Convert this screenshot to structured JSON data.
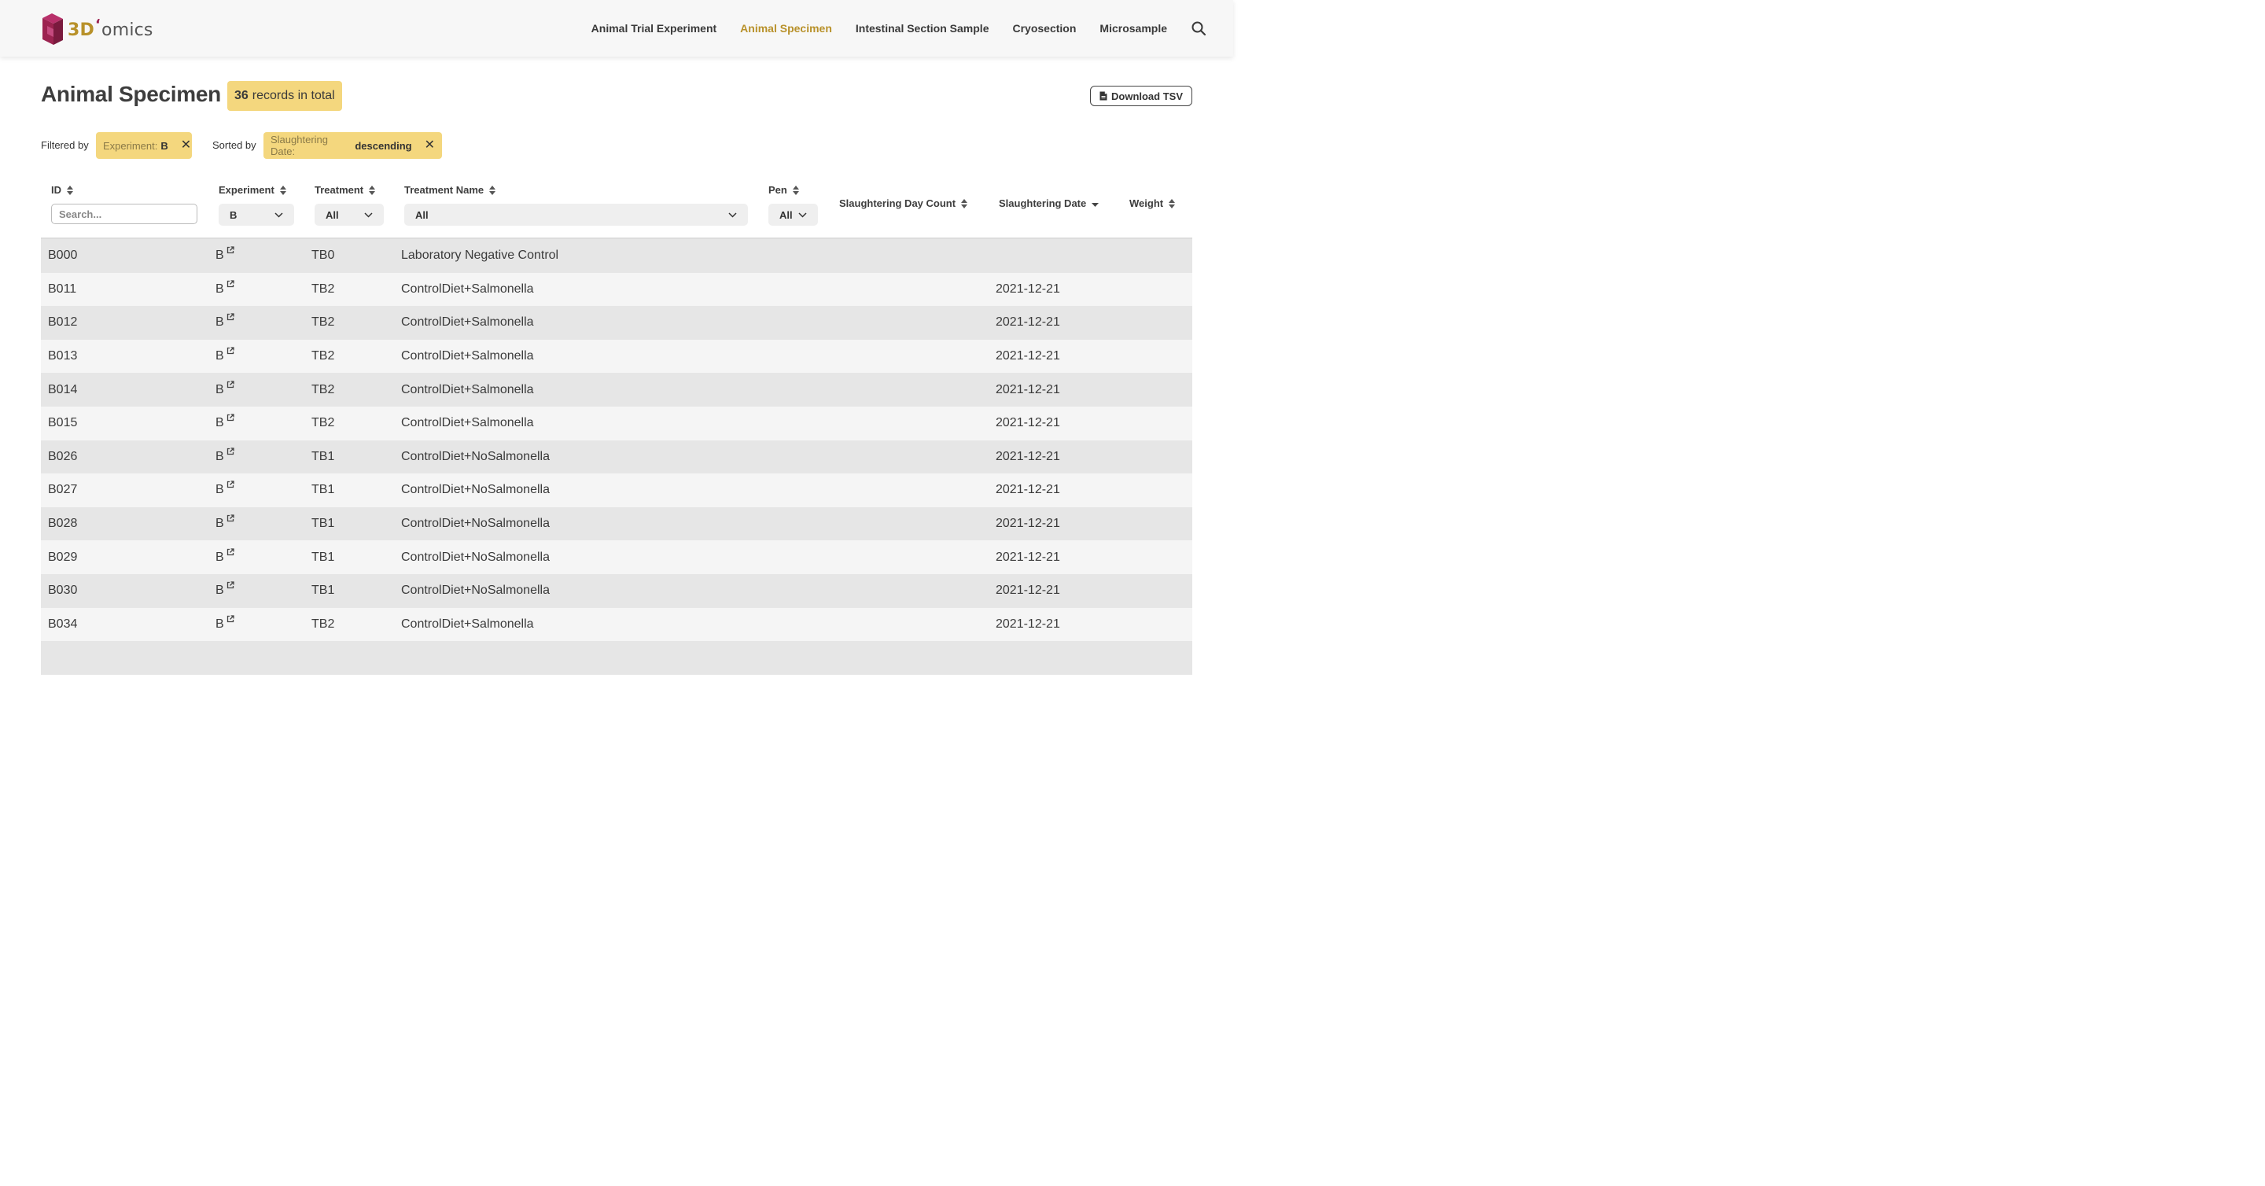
{
  "app": {
    "logo_3d": "3D",
    "logo_omics": "omics"
  },
  "nav": {
    "items": [
      {
        "label": "Animal Trial Experiment",
        "active": false
      },
      {
        "label": "Animal Specimen",
        "active": true
      },
      {
        "label": "Intestinal Section Sample",
        "active": false
      },
      {
        "label": "Cryosection",
        "active": false
      },
      {
        "label": "Microsample",
        "active": false
      }
    ],
    "search_icon": "search-icon"
  },
  "page": {
    "title": "Animal Specimen",
    "records_count": "36",
    "records_text": "records in total",
    "download_label": "Download TSV"
  },
  "filters": {
    "filtered_by_label": "Filtered by",
    "filter_chip_key": "Experiment:",
    "filter_chip_value": "B",
    "sorted_by_label": "Sorted by",
    "sort_chip_key": "Slaughtering Date:",
    "sort_chip_value": "descending"
  },
  "table": {
    "columns": {
      "id": "ID",
      "experiment": "Experiment",
      "treatment": "Treatment",
      "treatment_name": "Treatment Name",
      "pen": "Pen",
      "slaughtering_day_count": "Slaughtering Day Count",
      "slaughtering_date": "Slaughtering Date",
      "weight": "Weight"
    },
    "search_placeholder": "Search...",
    "selects": {
      "experiment": "B",
      "treatment": "All",
      "treatment_name": "All",
      "pen": "All"
    },
    "rows": [
      {
        "id": "B000",
        "experiment": "B",
        "treatment": "TB0",
        "treatment_name": "Laboratory Negative Control",
        "slaughtering_date": ""
      },
      {
        "id": "B011",
        "experiment": "B",
        "treatment": "TB2",
        "treatment_name": "ControlDiet+Salmonella",
        "slaughtering_date": "2021-12-21"
      },
      {
        "id": "B012",
        "experiment": "B",
        "treatment": "TB2",
        "treatment_name": "ControlDiet+Salmonella",
        "slaughtering_date": "2021-12-21"
      },
      {
        "id": "B013",
        "experiment": "B",
        "treatment": "TB2",
        "treatment_name": "ControlDiet+Salmonella",
        "slaughtering_date": "2021-12-21"
      },
      {
        "id": "B014",
        "experiment": "B",
        "treatment": "TB2",
        "treatment_name": "ControlDiet+Salmonella",
        "slaughtering_date": "2021-12-21"
      },
      {
        "id": "B015",
        "experiment": "B",
        "treatment": "TB2",
        "treatment_name": "ControlDiet+Salmonella",
        "slaughtering_date": "2021-12-21"
      },
      {
        "id": "B026",
        "experiment": "B",
        "treatment": "TB1",
        "treatment_name": "ControlDiet+NoSalmonella",
        "slaughtering_date": "2021-12-21"
      },
      {
        "id": "B027",
        "experiment": "B",
        "treatment": "TB1",
        "treatment_name": "ControlDiet+NoSalmonella",
        "slaughtering_date": "2021-12-21"
      },
      {
        "id": "B028",
        "experiment": "B",
        "treatment": "TB1",
        "treatment_name": "ControlDiet+NoSalmonella",
        "slaughtering_date": "2021-12-21"
      },
      {
        "id": "B029",
        "experiment": "B",
        "treatment": "TB1",
        "treatment_name": "ControlDiet+NoSalmonella",
        "slaughtering_date": "2021-12-21"
      },
      {
        "id": "B030",
        "experiment": "B",
        "treatment": "TB1",
        "treatment_name": "ControlDiet+NoSalmonella",
        "slaughtering_date": "2021-12-21"
      },
      {
        "id": "B034",
        "experiment": "B",
        "treatment": "TB2",
        "treatment_name": "ControlDiet+Salmonella",
        "slaughtering_date": "2021-12-21"
      },
      {
        "id": "",
        "experiment": "",
        "treatment": "",
        "treatment_name": "",
        "slaughtering_date": ""
      }
    ]
  },
  "colors": {
    "accent": "#b8912a",
    "badge_bg": "#f4d77e",
    "row_odd": "#e6e6e6",
    "row_even": "#f5f5f5",
    "logo_cube": "#9c2350"
  }
}
